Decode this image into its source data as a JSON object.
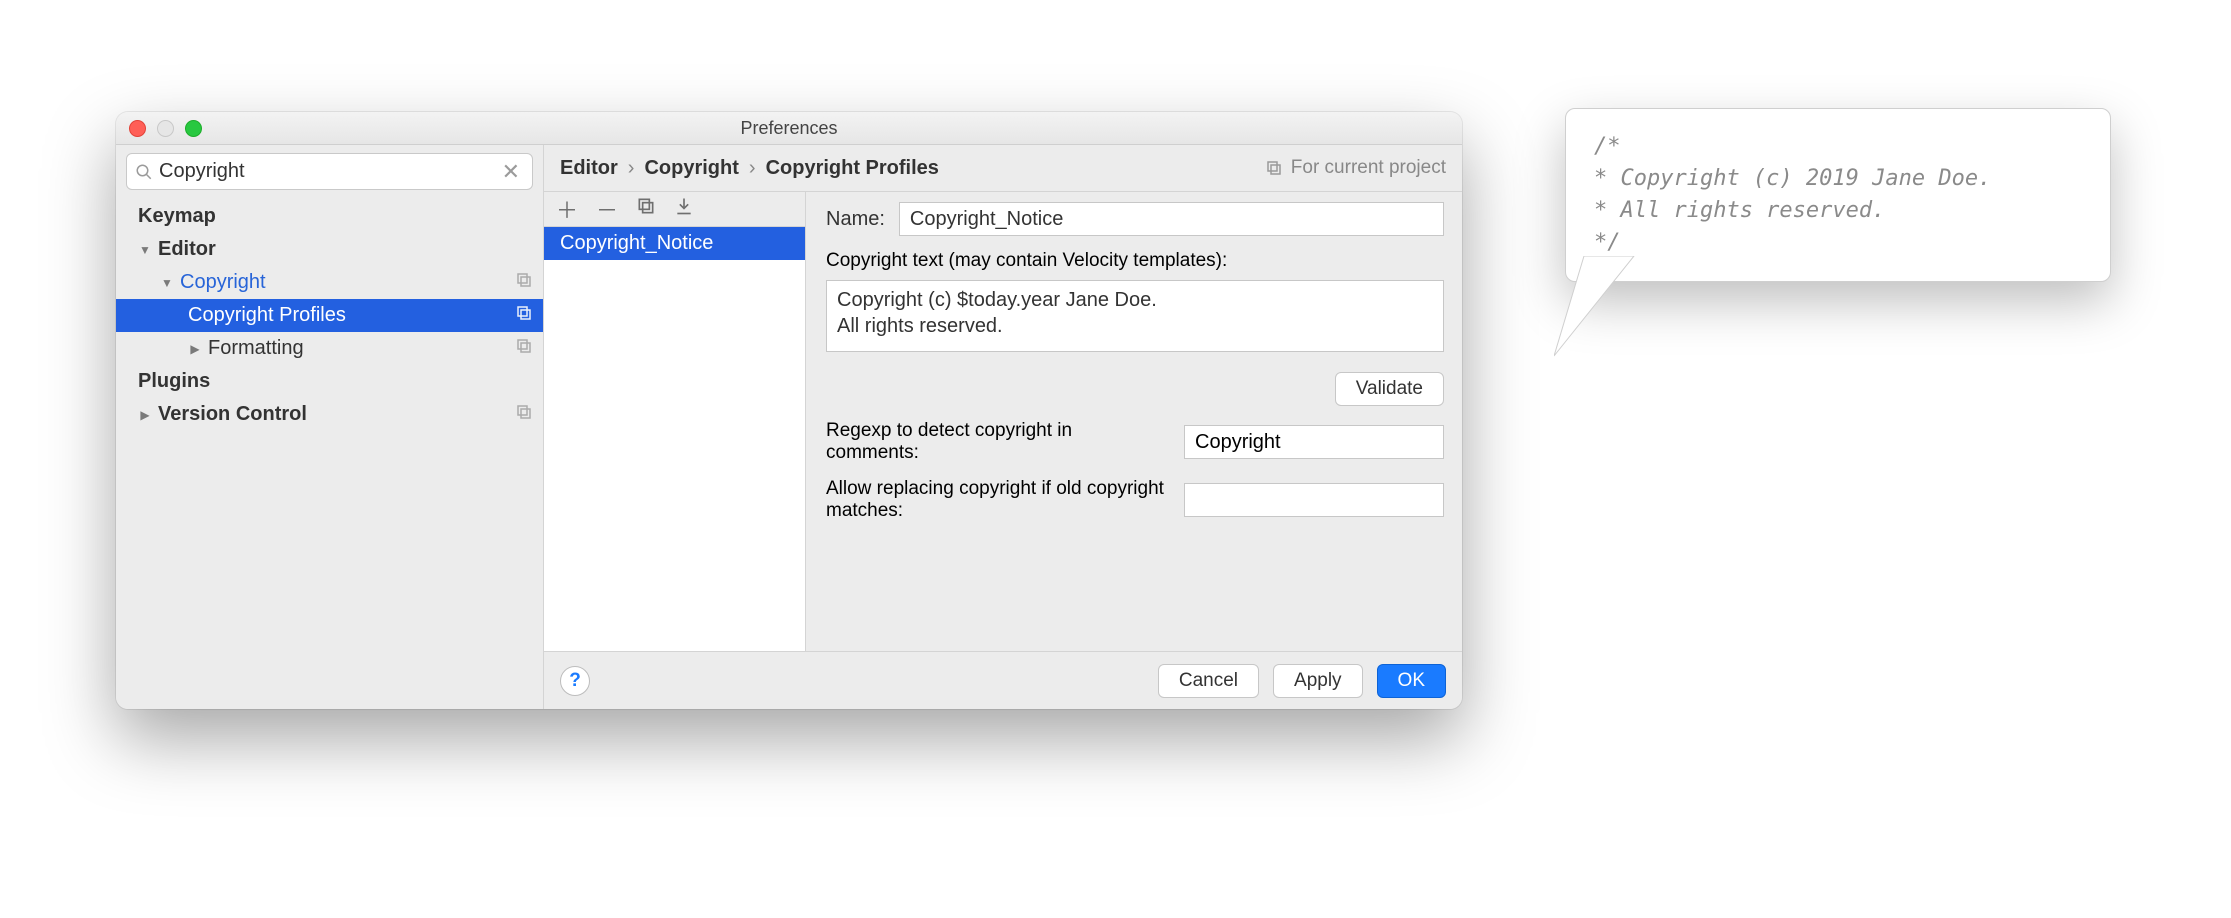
{
  "window": {
    "title": "Preferences"
  },
  "search": {
    "value": "Copyright"
  },
  "sidebar": {
    "items": [
      {
        "label": "Keymap"
      },
      {
        "label": "Editor"
      },
      {
        "label": "Copyright"
      },
      {
        "label": "Copyright Profiles"
      },
      {
        "label": "Formatting"
      },
      {
        "label": "Plugins"
      },
      {
        "label": "Version Control"
      }
    ]
  },
  "breadcrumb": {
    "a": "Editor",
    "b": "Copyright",
    "c": "Copyright Profiles"
  },
  "scope": {
    "label": "For current project"
  },
  "profiles": {
    "selected": "Copyright_Notice"
  },
  "form": {
    "name_label": "Name:",
    "name_value": "Copyright_Notice",
    "text_label": "Copyright text (may contain Velocity templates):",
    "text_value": "Copyright (c) $today.year Jane Doe.\nAll rights reserved.",
    "validate_label": "Validate",
    "regexp_label": "Regexp to detect copyright in comments:",
    "regexp_value": "Copyright",
    "allow_label": "Allow replacing copyright if old copyright matches:",
    "allow_value": ""
  },
  "footer": {
    "cancel": "Cancel",
    "apply": "Apply",
    "ok": "OK"
  },
  "callout": {
    "l1": "/*",
    "l2": " * Copyright (c) 2019 Jane Doe.",
    "l3": " * All rights reserved.",
    "l4": " */"
  }
}
